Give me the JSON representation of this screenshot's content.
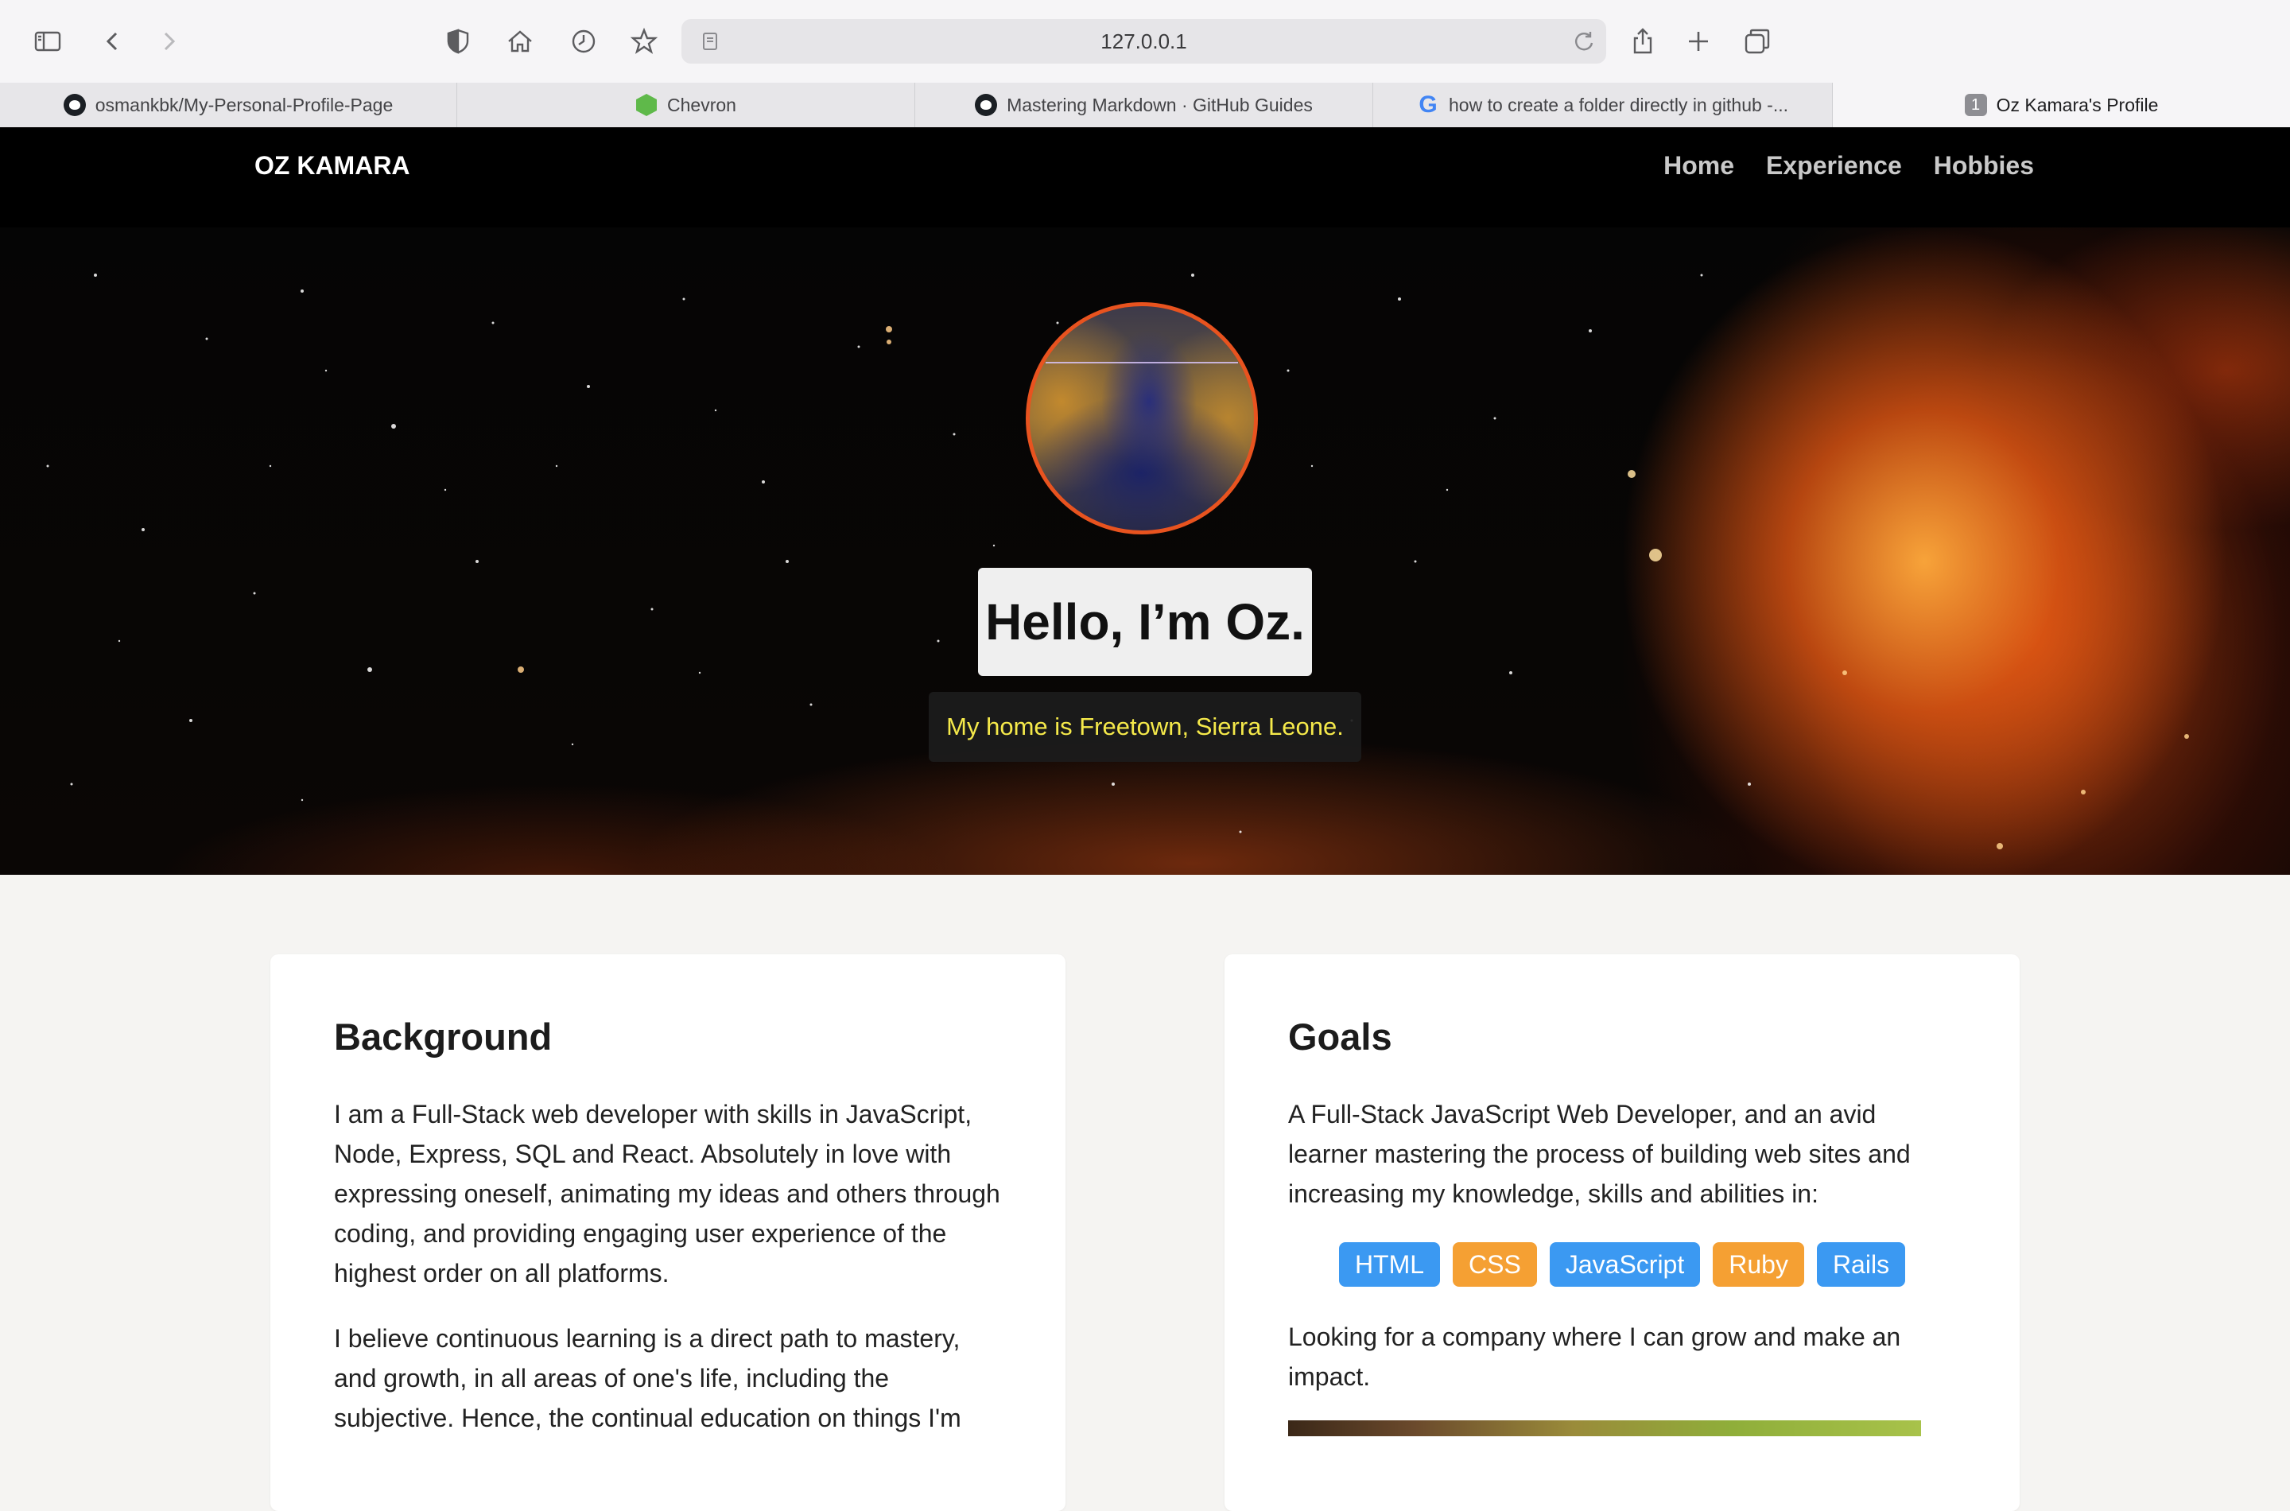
{
  "browser": {
    "url": "127.0.0.1",
    "tabs": [
      {
        "label": "osmankbk/My-Personal-Profile-Page",
        "icon": "github-icon"
      },
      {
        "label": "Chevron",
        "icon": "chevron-logo-icon"
      },
      {
        "label": "Mastering Markdown · GitHub Guides",
        "icon": "github-icon"
      },
      {
        "label": "how to create a folder directly in github -...",
        "icon": "google-icon"
      },
      {
        "label": "Oz Kamara's Profile",
        "icon": "tab-number-icon",
        "badge": "1",
        "active": true
      }
    ]
  },
  "site": {
    "brand": "OZ KAMARA",
    "nav": [
      "Home",
      "Experience",
      "Hobbies"
    ]
  },
  "hero": {
    "greeting": "Hello, I’m Oz.",
    "hometown": "My home is Freetown, Sierra Leone."
  },
  "background": {
    "heading": "Background",
    "paragraph_1": "I am a Full-Stack web developer with skills in JavaScript, Node, Express, SQL and React. Absolutely in love with expressing oneself, animating my ideas and others through coding, and providing engaging user experience of the highest order on all platforms.",
    "paragraph_2": "I believe continuous learning is a direct path to mastery, and growth, in all areas of one's life, including the subjective. Hence, the continual education on things I'm"
  },
  "goals": {
    "heading": "Goals",
    "paragraph_1": "A Full-Stack JavaScript Web Developer, and an avid learner mastering the process of building web sites and increasing my knowledge, skills and abilities in:",
    "skills": [
      {
        "label": "HTML",
        "color": "#3b99f2"
      },
      {
        "label": "CSS",
        "color": "#f5a033"
      },
      {
        "label": "JavaScript",
        "color": "#3b99f2"
      },
      {
        "label": "Ruby",
        "color": "#f5a033"
      },
      {
        "label": "Rails",
        "color": "#3b99f2"
      }
    ],
    "paragraph_2": "Looking for a company where I can grow and make an impact."
  }
}
